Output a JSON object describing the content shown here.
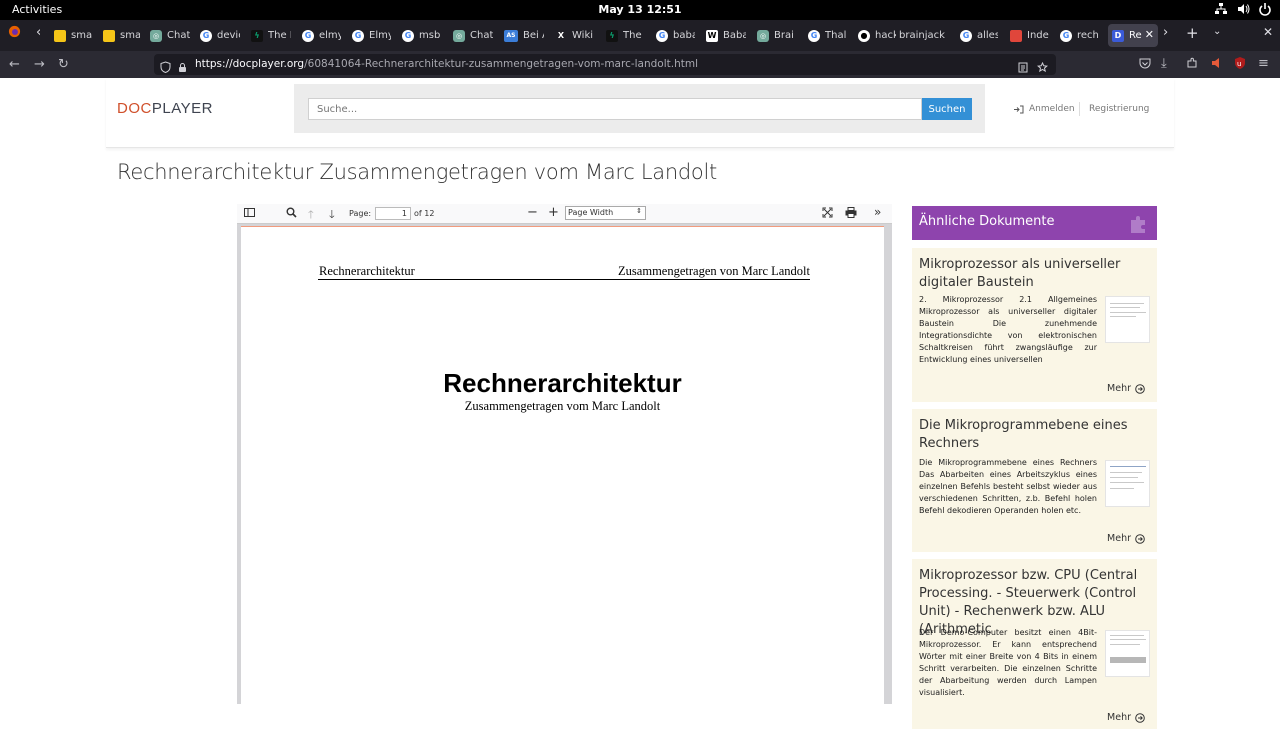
{
  "system": {
    "activities": "Activities",
    "clock": "May 13  12:51"
  },
  "browser": {
    "tabs": [
      {
        "label": "sma",
        "icon": "yellow-bookmark-icon",
        "color": "#f5c518"
      },
      {
        "label": "sma",
        "icon": "yellow-bookmark-icon",
        "color": "#f5c518"
      },
      {
        "label": "Chat",
        "icon": "chat-icon",
        "color": "#74aa9c"
      },
      {
        "label": "devic",
        "icon": "google-icon",
        "color": "#ffffff"
      },
      {
        "label": "The I",
        "icon": "bolt-icon",
        "color": "#0aa06e"
      },
      {
        "label": "elmy",
        "icon": "google-icon",
        "color": "#ffffff"
      },
      {
        "label": "Elmy",
        "icon": "google-icon",
        "color": "#ffffff"
      },
      {
        "label": "msb",
        "icon": "google-icon",
        "color": "#ffffff"
      },
      {
        "label": "Chat",
        "icon": "chat-icon",
        "color": "#74aa9c"
      },
      {
        "label": "Bei A",
        "icon": "as-icon",
        "color": "#3b7dd8"
      },
      {
        "label": "Wiki",
        "icon": "x-icon",
        "color": "#000000"
      },
      {
        "label": "The I",
        "icon": "bolt-icon",
        "color": "#0aa06e"
      },
      {
        "label": "baba",
        "icon": "google-icon",
        "color": "#ffffff"
      },
      {
        "label": "Baba",
        "icon": "wikipedia-icon",
        "color": "#ffffff"
      },
      {
        "label": "Brai",
        "icon": "chat-icon",
        "color": "#74aa9c"
      },
      {
        "label": "Thal",
        "icon": "google-icon",
        "color": "#ffffff"
      },
      {
        "label": "hack",
        "icon": "github-icon",
        "color": "#ffffff"
      },
      {
        "label": "brainjack",
        "icon": "",
        "color": ""
      },
      {
        "label": "alles",
        "icon": "google-icon",
        "color": "#ffffff"
      },
      {
        "label": "Inde",
        "icon": "red-doc-icon",
        "color": "#e0463b"
      },
      {
        "label": "rech",
        "icon": "google-icon",
        "color": "#ffffff"
      },
      {
        "label": "Re",
        "icon": "docplayer-icon",
        "color": "#3b5bd8"
      }
    ],
    "url_host": "https://docplayer.org",
    "url_path": "/60841064-Rechnerarchitektur-zusammengetragen-vom-marc-landolt.html"
  },
  "site": {
    "logo_doc": "DOC",
    "logo_player": "PLAYER",
    "search_placeholder": "Suche...",
    "search_button": "Suchen",
    "login": "Anmelden",
    "register": "Registrierung"
  },
  "document": {
    "title": "Rechnerarchitektur Zusammengetragen vom Marc Landolt",
    "viewer": {
      "page_label": "Page:",
      "page_number": "1",
      "page_count": "of 12",
      "zoom": "Page Width"
    },
    "page": {
      "header_left": "Rechnerarchitektur",
      "header_right": "Zusammengetragen von Marc Landolt",
      "big_title": "Rechnerarchitektur",
      "subtitle": "Zusammengetragen vom Marc Landolt"
    }
  },
  "similar": {
    "heading": "Ähnliche Dokumente",
    "more_label": "Mehr",
    "items": [
      {
        "title": "Mikroprozessor als universeller digitaler Baustein",
        "excerpt": "2. Mikroprozessor 2.1 Allgemeines Mikroprozessor als universeller digitaler Baustein Die zunehmende Integrationsdichte von elektronischen Schaltkreisen führt zwangsläufige zur Entwicklung eines universellen"
      },
      {
        "title": "Die Mikroprogrammebene eines Rechners",
        "excerpt": "Die Mikroprogrammebene eines Rechners Das Abarbeiten eines Arbeitszyklus eines einzelnen Befehls besteht selbst wieder aus verschiedenen Schritten, z.b. Befehl holen Befehl dekodieren Operanden holen etc."
      },
      {
        "title": "Mikroprozessor bzw. CPU (Central Processing. - Steuerwerk (Control Unit) - Rechenwerk bzw. ALU (Arithmetic",
        "excerpt": "Der Demo-Computer besitzt einen 4Bit-Mikroprozessor. Er kann entsprechend Wörter mit einer Breite von 4 Bits in einem Schritt verarbeiten. Die einzelnen Schritte der Abarbeitung werden durch Lampen visualisiert."
      }
    ]
  }
}
